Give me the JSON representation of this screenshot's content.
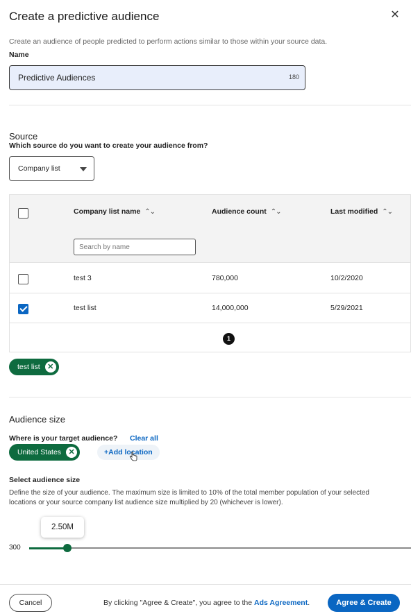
{
  "modal": {
    "title": "Create a predictive audience",
    "close_icon": "close-icon",
    "description": "Create an audience of people predicted to perform actions similar to those within your source data."
  },
  "name": {
    "label": "Name",
    "value": "Predictive Audiences",
    "char_count": "180"
  },
  "source": {
    "title": "Source",
    "question": "Which source do you want to create your audience from?",
    "selected": "Company list"
  },
  "table": {
    "columns": [
      "Company list name",
      "Audience count",
      "Last modified"
    ],
    "search_placeholder": "Search by name",
    "rows": [
      {
        "name": "test 3",
        "count": "780,000",
        "modified": "10/2/2020",
        "checked": false
      },
      {
        "name": "test list",
        "count": "14,000,000",
        "modified": "5/29/2021",
        "checked": true
      }
    ],
    "page": "1"
  },
  "selected_chip": "test list",
  "audience": {
    "title": "Audience size",
    "where_label": "Where is your target audience?",
    "clear_all": "Clear all",
    "location_chip": "United States",
    "add_location": "+Add location",
    "size_label": "Select audience size",
    "size_desc_line1": "Define the size of your audience. The maximum size is limited to 10% of the total member population of your selected",
    "size_desc_line2": "locations or your source company list audience size multiplied by 20 (whichever is lower).",
    "slider_min": "300",
    "slider_value": "2.50M",
    "slider_fraction": 0.1,
    "accent_color": "#0e6b3f"
  },
  "footer": {
    "cancel": "Cancel",
    "agree_text": "By clicking \"Agree & Create\", you agree to the",
    "agree_link": "Ads Agreement",
    "agree_period": ".",
    "agree_button": "Agree & Create",
    "primary_color": "#0a66c2"
  }
}
